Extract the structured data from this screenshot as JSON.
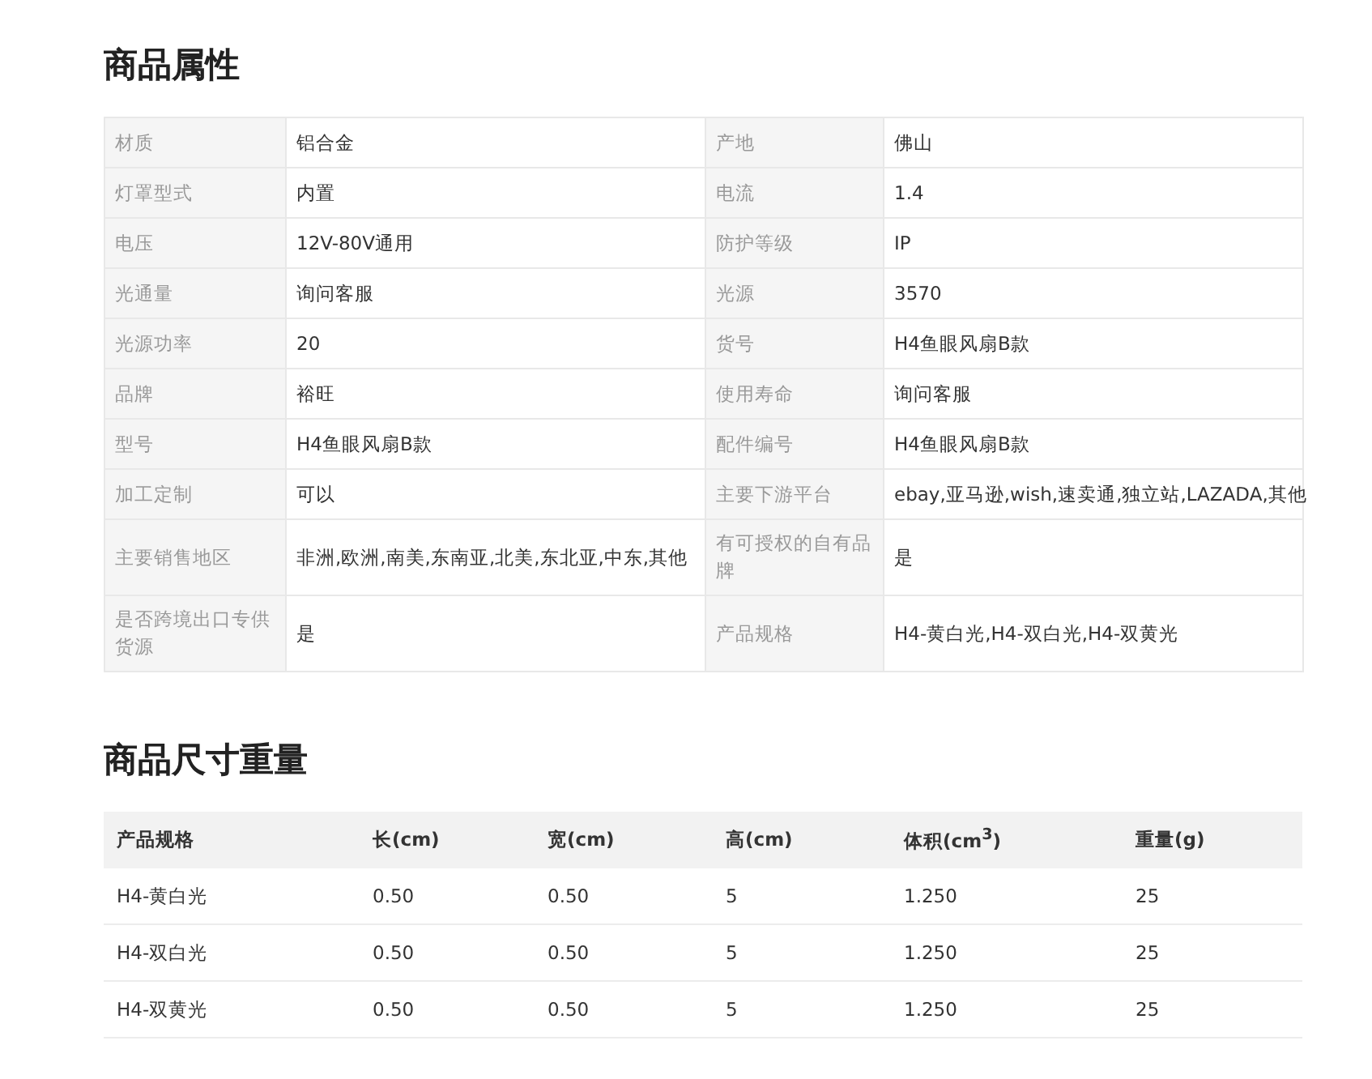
{
  "attributes": {
    "title": "商品属性",
    "rows": [
      {
        "pairs": [
          {
            "label": "材质",
            "value": "铝合金"
          },
          {
            "label": "产地",
            "value": "佛山"
          }
        ]
      },
      {
        "pairs": [
          {
            "label": "灯罩型式",
            "value": "内置"
          },
          {
            "label": "电流",
            "value": "1.4"
          }
        ]
      },
      {
        "pairs": [
          {
            "label": "电压",
            "value": "12V-80V通用"
          },
          {
            "label": "防护等级",
            "value": "IP"
          }
        ]
      },
      {
        "pairs": [
          {
            "label": "光通量",
            "value": "询问客服"
          },
          {
            "label": "光源",
            "value": "3570"
          }
        ]
      },
      {
        "pairs": [
          {
            "label": "光源功率",
            "value": "20"
          },
          {
            "label": "货号",
            "value": "H4鱼眼风扇B款"
          }
        ]
      },
      {
        "pairs": [
          {
            "label": "品牌",
            "value": "裕旺"
          },
          {
            "label": "使用寿命",
            "value": "询问客服"
          }
        ]
      },
      {
        "pairs": [
          {
            "label": "型号",
            "value": "H4鱼眼风扇B款"
          },
          {
            "label": "配件编号",
            "value": "H4鱼眼风扇B款"
          }
        ]
      },
      {
        "pairs": [
          {
            "label": "加工定制",
            "value": "可以"
          },
          {
            "label": "主要下游平台",
            "value": "ebay,亚马逊,wish,速卖通,独立站,LAZADA,其他"
          }
        ]
      },
      {
        "pairs": [
          {
            "label": "主要销售地区",
            "value": "非洲,欧洲,南美,东南亚,北美,东北亚,中东,其他"
          },
          {
            "label": "有可授权的自有品牌",
            "value": "是"
          }
        ]
      },
      {
        "pairs": [
          {
            "label": "是否跨境出口专供货源",
            "value": "是"
          },
          {
            "label": "产品规格",
            "value": "H4-黄白光,H4-双白光,H4-双黄光"
          }
        ]
      }
    ]
  },
  "dimensions": {
    "title": "商品尺寸重量",
    "columns": [
      "产品规格",
      "长(cm)",
      "宽(cm)",
      "高(cm)",
      "体积(cm$^{3}$)",
      "重量(g)"
    ],
    "rows": [
      [
        "H4-黄白光",
        "0.50",
        "0.50",
        "5",
        "1.250",
        "25"
      ],
      [
        "H4-双白光",
        "0.50",
        "0.50",
        "5",
        "1.250",
        "25"
      ],
      [
        "H4-双黄光",
        "0.50",
        "0.50",
        "5",
        "1.250",
        "25"
      ]
    ]
  }
}
